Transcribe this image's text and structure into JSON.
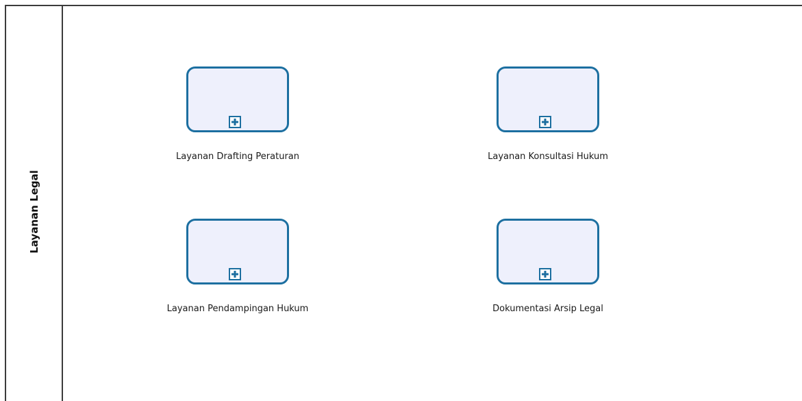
{
  "lane": {
    "label": "Layanan Legal"
  },
  "tasks": [
    {
      "label": "Layanan Drafting Peraturan",
      "marker_icon": "plus-icon",
      "type": "collapsed-subprocess"
    },
    {
      "label": "Layanan Konsultasi Hukum",
      "marker_icon": "plus-icon",
      "type": "collapsed-subprocess"
    },
    {
      "label": "Layanan Pendampingan Hukum",
      "marker_icon": "plus-icon",
      "type": "collapsed-subprocess"
    },
    {
      "label": "Dokumentasi Arsip Legal",
      "marker_icon": "plus-icon",
      "type": "collapsed-subprocess"
    }
  ],
  "colors": {
    "task_border": "#1c6fa0",
    "task_fill": "#eef0fc",
    "lane_border": "#3b3b3b"
  }
}
